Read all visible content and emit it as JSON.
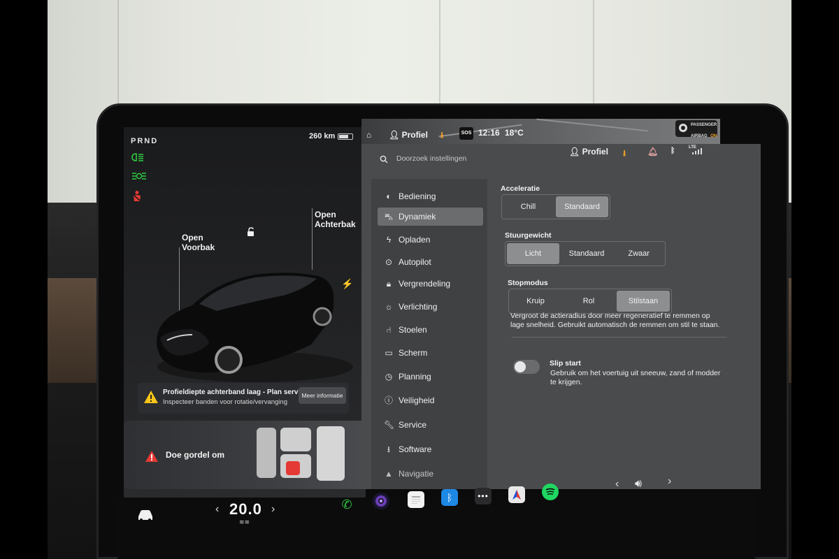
{
  "status": {
    "gear": "PRND",
    "range": "260 km",
    "profile_top": "Profiel",
    "sos": "SOS",
    "time": "12:16",
    "temperature": "18°C",
    "airbag_line1": "PASSENGER",
    "airbag_line2": "AIRBAG",
    "airbag_state": "ON"
  },
  "car": {
    "callout_frunk_1": "Open",
    "callout_frunk_2": "Voorbak",
    "callout_trunk_1": "Open",
    "callout_trunk_2": "Achterbak"
  },
  "alert": {
    "title": "Profieldiepte achterband laag - Plan service",
    "subtitle": "Inspecteer banden voor rotatie/vervanging",
    "button": "Meer informatie"
  },
  "seatbelt": {
    "text": "Doe gordel om"
  },
  "settings": {
    "search_placeholder": "Doorzoek instellingen",
    "profile": "Profiel",
    "lte": "LTE",
    "nav": [
      {
        "label": "Bediening",
        "icon": "toggle-icon"
      },
      {
        "label": "Dynamiek",
        "icon": "car-icon"
      },
      {
        "label": "Opladen",
        "icon": "bolt-icon"
      },
      {
        "label": "Autopilot",
        "icon": "steering-wheel-icon"
      },
      {
        "label": "Vergrendeling",
        "icon": "lock-icon"
      },
      {
        "label": "Verlichting",
        "icon": "sun-icon"
      },
      {
        "label": "Stoelen",
        "icon": "seat-icon"
      },
      {
        "label": "Scherm",
        "icon": "display-icon"
      },
      {
        "label": "Planning",
        "icon": "clock-icon"
      },
      {
        "label": "Veiligheid",
        "icon": "info-icon"
      },
      {
        "label": "Service",
        "icon": "wrench-icon"
      },
      {
        "label": "Software",
        "icon": "download-icon"
      },
      {
        "label": "Navigatie",
        "icon": "navigation-icon"
      }
    ],
    "acceleration": {
      "label": "Acceleratie",
      "options": [
        "Chill",
        "Standaard"
      ],
      "selected": "Standaard"
    },
    "steering": {
      "label": "Stuurgewicht",
      "options": [
        "Licht",
        "Standaard",
        "Zwaar"
      ],
      "selected": "Licht"
    },
    "stopmode": {
      "label": "Stopmodus",
      "options": [
        "Kruip",
        "Rol",
        "Stilstaan"
      ],
      "selected": "Stilstaan",
      "description_1": "Vergroot de actieradius door meer regeneratief te remmen op",
      "description_2": "lage snelheid. Gebruikt automatisch de remmen om stil te staan."
    },
    "slip_start": {
      "label": "Slip start",
      "description_1": "Gebruik om het voertuig uit sneeuw, zand of modder",
      "description_2": "te krijgen.",
      "enabled": false
    }
  },
  "dock": {
    "cabin_temp": "20.0",
    "apps": [
      "phone-icon",
      "camera-icon",
      "calendar-icon",
      "bluetooth-icon",
      "more-icon",
      "navigate-icon",
      "spotify-icon"
    ],
    "colors": {
      "phone": "#2ecc40",
      "bluetooth": "#1e88e5",
      "spotify": "#1ed760"
    }
  }
}
